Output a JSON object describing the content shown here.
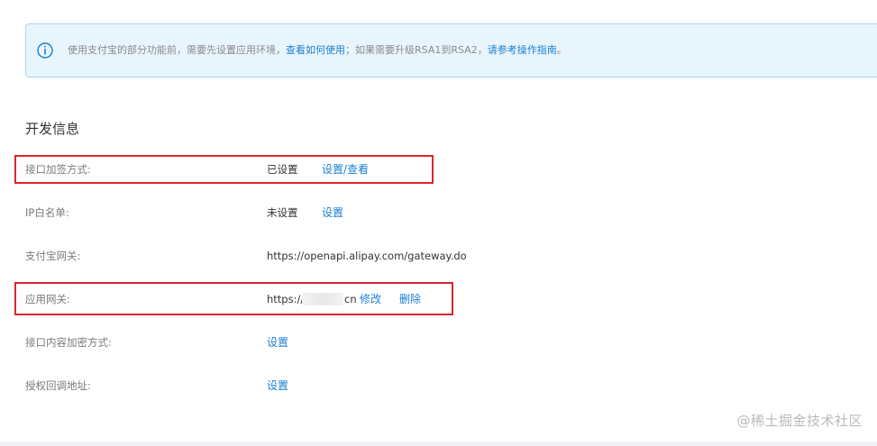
{
  "notice": {
    "icon": "info-circle-icon",
    "text_before": "使用支付宝的部分功能前，需要先设置应用环境，",
    "link1": "查看如何使用",
    "text_middle": "；如果需要升级RSA1到RSA2，",
    "link2": "请参考操作指南",
    "text_end": "。"
  },
  "section": {
    "title": "开发信息"
  },
  "rows": {
    "sign_method": {
      "label": "接口加签方式:",
      "value": "已设置",
      "action": "设置/查看"
    },
    "ip_whitelist": {
      "label": "IP白名单:",
      "value": "未设置",
      "action": "设置"
    },
    "alipay_gateway": {
      "label": "支付宝网关:",
      "value": "https://openapi.alipay.com/gateway.do"
    },
    "app_gateway": {
      "label": "应用网关:",
      "value_prefix": "https://s",
      "value_suffix": "cn",
      "action_edit": "修改",
      "action_delete": "删除"
    },
    "content_encrypt": {
      "label": "接口内容加密方式:",
      "action": "设置"
    },
    "auth_callback": {
      "label": "授权回调地址:",
      "action": "设置"
    }
  },
  "watermark": "@稀土掘金技术社区",
  "colors": {
    "link": "#1a7fd4",
    "notice_bg": "#e9f5fd",
    "notice_border": "#a7d4f2",
    "highlight": "#d9262c"
  }
}
